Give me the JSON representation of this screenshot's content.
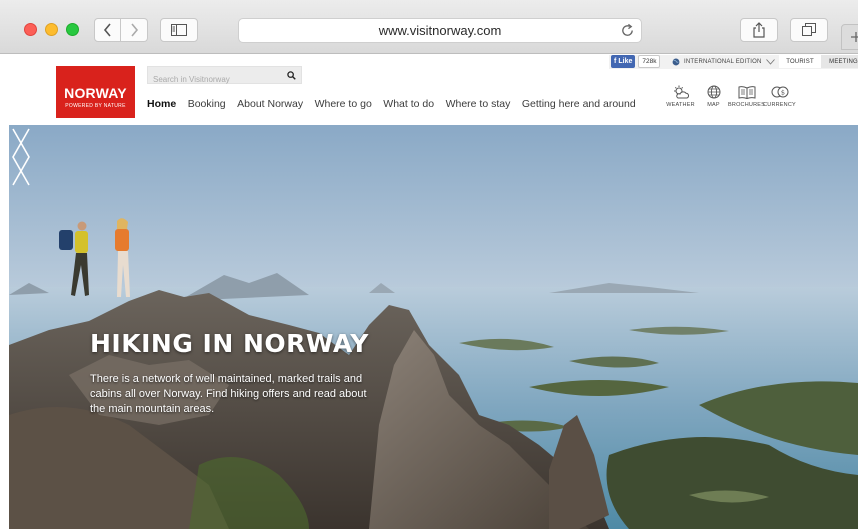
{
  "browser": {
    "url": "www.visitnorway.com"
  },
  "header": {
    "logo": {
      "word": "NORWAY",
      "tagline": "POWERED BY NATURE"
    },
    "search_placeholder": "Search in Visitnorway",
    "nav": [
      "Home",
      "Booking",
      "About Norway",
      "Where to go",
      "What to do",
      "Where to stay",
      "Getting here and around"
    ],
    "facebook": {
      "like_label": "Like",
      "count": "728k"
    },
    "edition_label": "INTERNATIONAL EDITION",
    "audience_tabs": [
      "TOURIST",
      "MEETING"
    ],
    "utilities": [
      "WEATHER",
      "MAP",
      "BROCHURES",
      "CURRENCY"
    ]
  },
  "hero": {
    "title": "HIKING IN NORWAY",
    "text": "There is a network of well maintained, marked trails and cabins all over Norway. Find hiking offers and read about the main mountain areas."
  },
  "colors": {
    "brand_red": "#d9221c",
    "facebook_blue": "#4267b2"
  }
}
